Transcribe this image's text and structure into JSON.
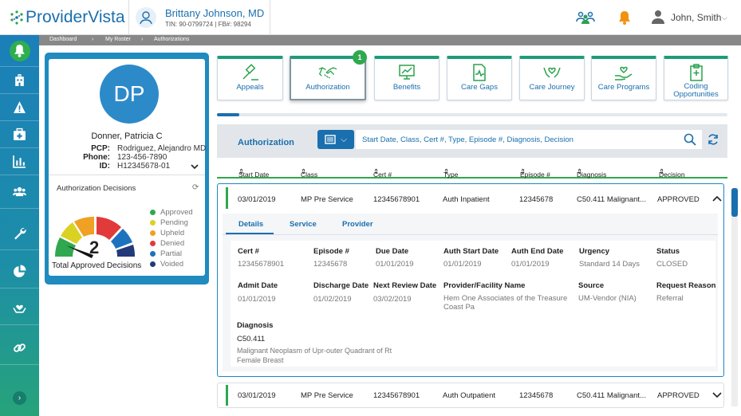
{
  "header": {
    "logo": "ProviderVista",
    "user_name": "Brittany Johnson, MD",
    "user_ids": "TIN: 90-0799724 | FB#: 98294",
    "login_name": "John, Smith"
  },
  "breadcrumb": [
    "Dashboard",
    "My Roster",
    "Authorizations"
  ],
  "patient": {
    "initials": "DP",
    "name": "Donner, Patricia C",
    "pcp_label": "PCP:",
    "pcp": "Rodriguez, Alejandro MD",
    "phone_label": "Phone:",
    "phone": "123-456-7890",
    "id_label": "ID:",
    "id": "H12345678-01"
  },
  "decisions": {
    "title": "Authorization Decisions",
    "total": "2",
    "total_label": "Total Approved Decisions",
    "legend": [
      {
        "label": "Approved",
        "color": "#2fa84f"
      },
      {
        "label": "Pending",
        "color": "#d9d223"
      },
      {
        "label": "Upheld",
        "color": "#f0a022"
      },
      {
        "label": "Denied",
        "color": "#e23a3a"
      },
      {
        "label": "Partial",
        "color": "#1d72c0"
      },
      {
        "label": "Voided",
        "color": "#223a7a"
      }
    ]
  },
  "tiles": [
    {
      "label": "Appeals",
      "icon": "gavel-icon"
    },
    {
      "label": "Authorization",
      "icon": "handshake-icon",
      "badge": "1"
    },
    {
      "label": "Benefits",
      "icon": "benefits-icon"
    },
    {
      "label": "Care Gaps",
      "icon": "care-gaps-icon"
    },
    {
      "label": "Care Journey",
      "icon": "care-journey-icon"
    },
    {
      "label": "Care Programs",
      "icon": "care-programs-icon"
    },
    {
      "label": "Coding Opportunities",
      "icon": "coding-icon"
    }
  ],
  "search": {
    "title": "Authorization",
    "placeholder": "Start Date, Class, Cert #, Type, Episode #, Diagnosis, Decision"
  },
  "columns": [
    "Start Date",
    "Class",
    "Cert #",
    "Type",
    "Episode #",
    "Diagnosis",
    "Decision"
  ],
  "rows": [
    {
      "start": "03/01/2019",
      "class": "MP Pre Service",
      "cert": "12345678901",
      "type": "Auth Inpatient",
      "episode": "12345678",
      "diagnosis": "C50.411 Malignant...",
      "decision": "APPROVED"
    },
    {
      "start": "03/01/2019",
      "class": "MP Pre Service",
      "cert": "12345678901",
      "type": "Auth Outpatient",
      "episode": "12345678",
      "diagnosis": "C50.411 Malignant...",
      "decision": "APPROVED"
    }
  ],
  "detail": {
    "tabs": [
      "Details",
      "Service",
      "Provider"
    ],
    "fields": [
      {
        "k": "Cert #",
        "v": "12345678901"
      },
      {
        "k": "Episode #",
        "v": "12345678"
      },
      {
        "k": "Due Date",
        "v": "01/01/2019"
      },
      {
        "k": "Auth Start Date",
        "v": "01/01/2019"
      },
      {
        "k": "Auth End Date",
        "v": "01/01/2019"
      },
      {
        "k": "Urgency",
        "v": "Standard 14 Days"
      },
      {
        "k": "Status",
        "v": "CLOSED"
      },
      {
        "k": "Admit Date",
        "v": "01/01/2019"
      },
      {
        "k": "Discharge Date",
        "v": "01/02/2019"
      },
      {
        "k": "Next Review Date",
        "v": "03/02/2019"
      },
      {
        "k": "Provider/Facility Name",
        "v": "Hem One Associates of the Treasure Coast Pa"
      },
      {
        "k": "Source",
        "v": "UM-Vendor (NIA)"
      },
      {
        "k": "Request Reason",
        "v": "Referral"
      }
    ],
    "diagnosis_label": "Diagnosis",
    "diagnosis_code": "C50.411",
    "diagnosis_desc": "Malignant Neoplasm of Upr-outer Quadrant of Rt Female Breast"
  }
}
